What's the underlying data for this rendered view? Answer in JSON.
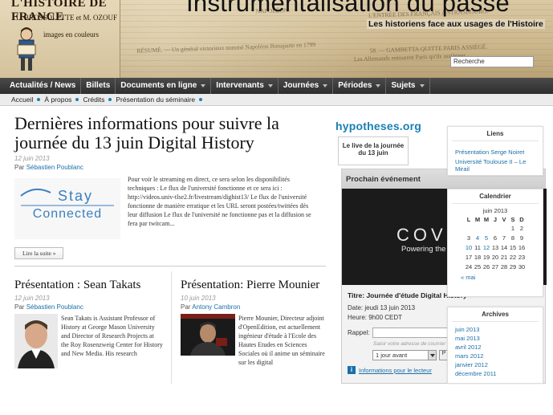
{
  "banner": {
    "paper_title": "L'HISTOIRE DE FRANCE",
    "authors": "L. BROSSOLETTE et M. OZOUF",
    "images_text": "images en couleurs",
    "site_title": "Instrumentalisation du passé",
    "subtitle": "Les historiens face aux usages de l'Histoire",
    "newsprint_lines": [
      "NAPOLÉON.",
      "L'ENTRÉE DES FRANÇAIS A STRASBOURG.",
      "RÉSUMÉ. — Un général victorieux nommé Napoléon Bonaparte en 1799",
      "58. — GAMBETTA QUITTE PARIS ASSIÉGÉ.",
      "Les Allemands entourent Paris qu'ils assiègent."
    ],
    "search_placeholder": "Recherche"
  },
  "nav": {
    "items": [
      {
        "label": "Actualités / News",
        "caret": false
      },
      {
        "label": "Billets",
        "caret": false
      },
      {
        "label": "Documents en ligne",
        "caret": true
      },
      {
        "label": "Intervenants",
        "caret": true
      },
      {
        "label": "Journées",
        "caret": true
      },
      {
        "label": "Périodes",
        "caret": true
      },
      {
        "label": "Sujets",
        "caret": true
      }
    ]
  },
  "subnav": {
    "items": [
      "Accueil",
      "À propos",
      "Crédits",
      "Présentation du séminaire"
    ]
  },
  "post1": {
    "title": "Dernières informations pour suivre la journée du 13 juin Digital History",
    "date": "12 juin 2013",
    "by": "Par",
    "author": "Sébastien Poublanc",
    "logo_top": "Stay",
    "logo_bottom": "Connected",
    "excerpt": "Pour voir le streaming en direct, ce sera selon les disponibilités techniques :  Le flux de l'université fonctionne et ce sera ici : http://videos.univ-tlse2.fr/livestream/dighist13/ Le flux de l'université fonctionne de manière erratique et les URL seront postées/twittées dès leur diffusion Le flux de l'université ne fonctionne pas et la diffusion se fera par twitcam...",
    "read_more": "Lire la suite »"
  },
  "post2": {
    "title": "Présentation : Sean Takats",
    "date": "12 juin 2013",
    "by": "Par",
    "author": "Sébastien Poublanc",
    "excerpt": "Sean Takats is Assistant Professor of History at George Mason University and Director of Research Projects at the Roy Rosenzweig Center for History and New Media. His research"
  },
  "post3": {
    "title": "Présentation: Pierre Mounier",
    "date": "10 juin 2013",
    "by": "Par",
    "author": "Antony Cambron",
    "excerpt": "Pierre Mounier, Directeur adjoint d'OpenEdition, est actuellement ingénieur d'étude à l'Ecole des Hautes Etudes en Sciences Sociales où il anime un séminaire sur les digital"
  },
  "sidebar": {
    "hypotheses": "hypotheses.org",
    "live_box": "Le live de la journée du 13 juin",
    "event_header": "Prochain événement",
    "event_image_brand": "COV",
    "event_image_tag": "Powering the",
    "event_title": "Titre: Journée d'étude Digital History",
    "event_date": "Date: jeudi 13 juin 2013",
    "event_time": "Heure: 9h00 CEDT",
    "rappel_label": "Rappel:",
    "email_hint": "Saisir votre adresse de courrier",
    "delay_value": "1 jour avant",
    "go_label": "P",
    "info_link": "Informations pour le lecteur"
  },
  "links_widget": {
    "title": "Liens",
    "items": [
      "Présentation Serge Noiret",
      "Université Toulouse II – Le Mirail"
    ]
  },
  "calendar": {
    "title": "Calendrier",
    "month": "juin 2013",
    "weekdays": [
      "L",
      "M",
      "M",
      "J",
      "V",
      "S",
      "D"
    ],
    "weeks": [
      [
        "",
        "",
        "",
        "",
        "",
        "1",
        "2"
      ],
      [
        "3",
        "4",
        "5",
        "6",
        "7",
        "8",
        "9"
      ],
      [
        "10",
        "11",
        "12",
        "13",
        "14",
        "15",
        "16"
      ],
      [
        "17",
        "18",
        "19",
        "20",
        "21",
        "22",
        "23"
      ],
      [
        "24",
        "25",
        "26",
        "27",
        "28",
        "29",
        "30"
      ]
    ],
    "linked_days": [
      "4",
      "5",
      "10",
      "12"
    ],
    "prev": "« mai"
  },
  "archives": {
    "title": "Archives",
    "items": [
      "juin 2013",
      "mai 2013",
      "avril 2012",
      "mars 2012",
      "janvier 2012",
      "décembre 2011"
    ]
  }
}
